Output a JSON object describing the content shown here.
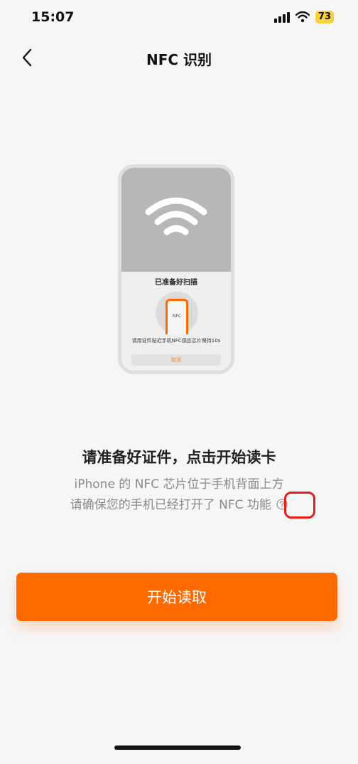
{
  "status_bar": {
    "time": "15:07",
    "battery": "73",
    "icons": [
      "signal-icon",
      "wifi-icon",
      "battery-icon"
    ]
  },
  "nav": {
    "back_icon": "chevron-left-icon",
    "title": "NFC 识别"
  },
  "illustration": {
    "scan_title": "已准备好扫描",
    "mini_phone_label": "NFC",
    "instruction": "请用证件贴近手机NFC感应芯片保持10s",
    "cancel_label": "取消"
  },
  "content": {
    "heading": "请准备好证件，点击开始读卡",
    "line1": "iPhone 的 NFC 芯片位于手机背面上方",
    "line2": "请确保您的手机已经打开了 NFC 功能",
    "help_icon": "question-circle-icon"
  },
  "actions": {
    "start_label": "开始读取"
  },
  "colors": {
    "accent": "#ff6a00",
    "highlight": "#e0201b",
    "background": "#f6f6f6"
  }
}
